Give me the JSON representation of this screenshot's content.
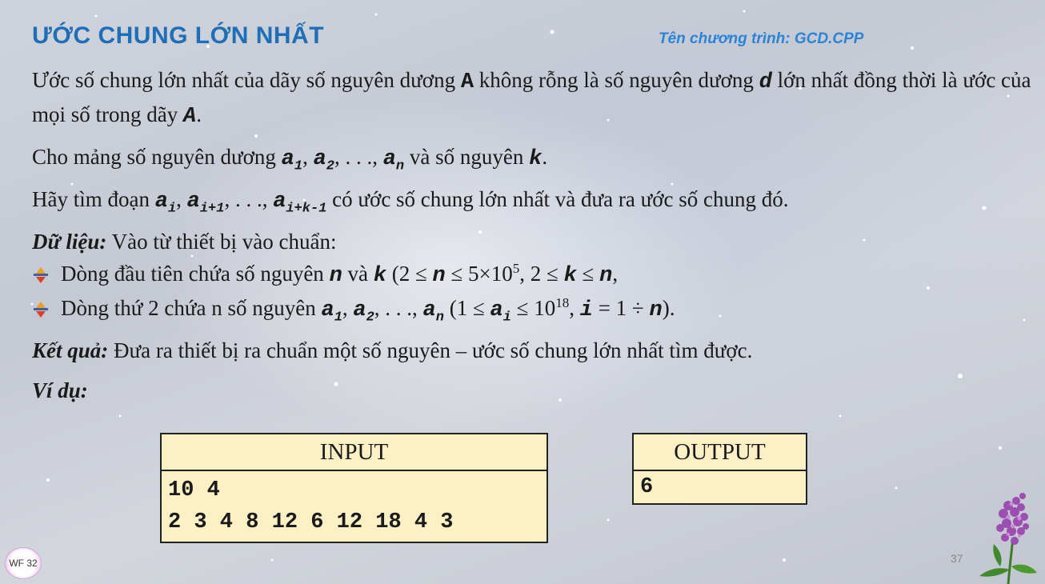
{
  "title": "ƯỚC CHUNG LỚN NHẤT",
  "program_name": "Tên chương trình: GCD.CPP",
  "para1": {
    "t1": "Ước số chung lớn nhất của dãy số nguyên dương ",
    "v1": "A",
    "t2": " không rỗng là số nguyên dương ",
    "v2": "d",
    "t3": " lớn nhất đồng thời là ước của mọi số trong dãy ",
    "v3": "A",
    "t4": "."
  },
  "para2": {
    "t1": "Cho mảng số nguyên dương ",
    "a": "a",
    "s1": "1",
    "s2": "2",
    "sn": "n",
    "comma": ", ",
    "dots": ", . . ., ",
    "t2": " và số nguyên ",
    "k": "k",
    "t3": "."
  },
  "para3": {
    "t1": "Hãy tìm đoạn ",
    "a": "a",
    "s1": "i",
    "s2": "i+1",
    "s3": "i+k-1",
    "comma": ", ",
    "dots": ", . . ., ",
    "t2": " có ước số chung lớn nhất và đưa ra ước số chung đó."
  },
  "input_section": {
    "label": "Dữ liệu:",
    "text": " Vào từ thiết bị vào chuẩn:",
    "bullet1": {
      "t1": "Dòng đầu tiên chứa số nguyên ",
      "n": "n",
      "t2": " và ",
      "k": "k",
      "t3": " (2 ≤ ",
      "t4": " ≤ 5×10",
      "sup": "5",
      "t5": ", 2 ≤ ",
      "t6": " ≤ ",
      "t7": ","
    },
    "bullet2": {
      "t1": "Dòng thứ 2 chứa n số nguyên ",
      "a": "a",
      "s1": "1",
      "s2": "2",
      "sn": "n",
      "si": "i",
      "comma": ", ",
      "dots": ", . . ., ",
      "t2": " (1 ≤ ",
      "t3": " ≤ 10",
      "sup": "18",
      "t4": ", ",
      "i": "i",
      "t5": " = 1 ÷ ",
      "n": "n",
      "t6": ")."
    }
  },
  "output_section": {
    "label": "Kết quả:",
    "text": " Đưa ra thiết bị ra chuẩn một số nguyên – ước số chung lớn nhất tìm được."
  },
  "example_label": "Ví dụ:",
  "example": {
    "input_header": "INPUT",
    "input_lines": [
      "10 4",
      "2 3 4 8 12 6 12 18 4 3"
    ],
    "output_header": "OUTPUT",
    "output_lines": [
      "6"
    ]
  },
  "page_number": "37",
  "badge": "WF 32",
  "colors": {
    "title": "#1f6fb8",
    "program": "#2a84d6",
    "table_bg": "#fdf0c4"
  }
}
